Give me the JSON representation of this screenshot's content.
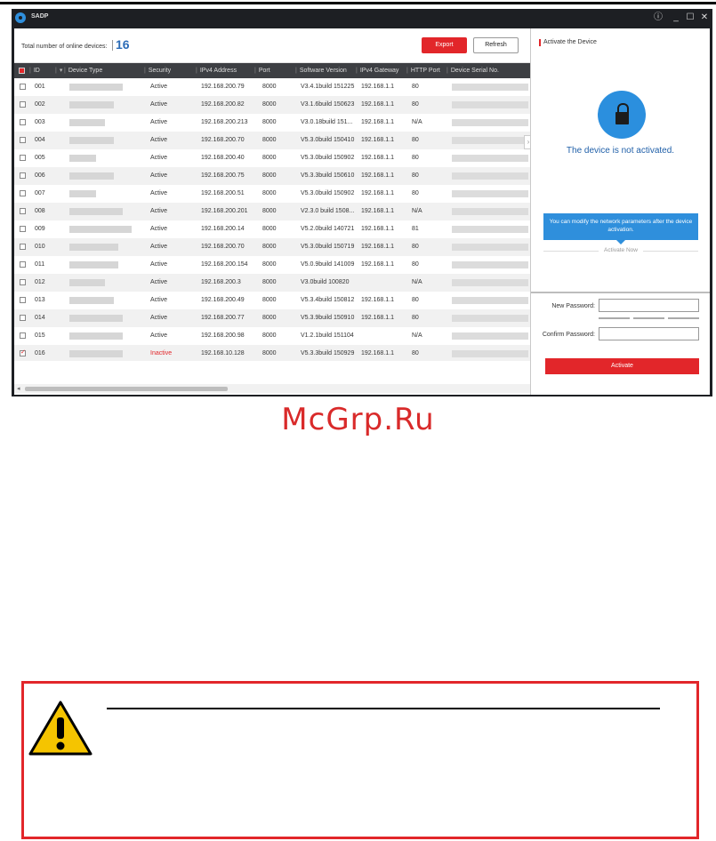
{
  "app": {
    "title": "SADP",
    "info_icon": "info-icon",
    "minimize_icon": "minimize-icon",
    "maximize_icon": "maximize-icon",
    "close_icon": "close-icon"
  },
  "toolbar": {
    "total_label": "Total number of online devices:",
    "total_count": "16",
    "export_label": "Export",
    "refresh_label": "Refresh"
  },
  "columns": [
    "ID",
    "Device Type",
    "Security",
    "IPv4 Address",
    "Port",
    "Software Version",
    "IPv4 Gateway",
    "HTTP Port",
    "Device Serial No."
  ],
  "rows": [
    {
      "id": "001",
      "security": "Active",
      "ip": "192.168.200.79",
      "port": "8000",
      "sw": "V3.4.1build 151225",
      "gw": "192.168.1.1",
      "http": "80",
      "checked": false
    },
    {
      "id": "002",
      "security": "Active",
      "ip": "192.168.200.82",
      "port": "8000",
      "sw": "V3.1.6build 150623",
      "gw": "192.168.1.1",
      "http": "80",
      "checked": false
    },
    {
      "id": "003",
      "security": "Active",
      "ip": "192.168.200.213",
      "port": "8000",
      "sw": "V3.0.18build 151...",
      "gw": "192.168.1.1",
      "http": "N/A",
      "checked": false
    },
    {
      "id": "004",
      "security": "Active",
      "ip": "192.168.200.70",
      "port": "8000",
      "sw": "V5.3.0build 150410",
      "gw": "192.168.1.1",
      "http": "80",
      "checked": false
    },
    {
      "id": "005",
      "security": "Active",
      "ip": "192.168.200.40",
      "port": "8000",
      "sw": "V5.3.0build 150902",
      "gw": "192.168.1.1",
      "http": "80",
      "checked": false
    },
    {
      "id": "006",
      "security": "Active",
      "ip": "192.168.200.75",
      "port": "8000",
      "sw": "V5.3.3build 150610",
      "gw": "192.168.1.1",
      "http": "80",
      "checked": false
    },
    {
      "id": "007",
      "security": "Active",
      "ip": "192.168.200.51",
      "port": "8000",
      "sw": "V5.3.0build 150902",
      "gw": "192.168.1.1",
      "http": "80",
      "checked": false
    },
    {
      "id": "008",
      "security": "Active",
      "ip": "192.168.200.201",
      "port": "8000",
      "sw": "V2.3.0 build 1508...",
      "gw": "192.168.1.1",
      "http": "N/A",
      "checked": false
    },
    {
      "id": "009",
      "security": "Active",
      "ip": "192.168.200.14",
      "port": "8000",
      "sw": "V5.2.0build 140721",
      "gw": "192.168.1.1",
      "http": "81",
      "checked": false
    },
    {
      "id": "010",
      "security": "Active",
      "ip": "192.168.200.70",
      "port": "8000",
      "sw": "V5.3.0build 150719",
      "gw": "192.168.1.1",
      "http": "80",
      "checked": false
    },
    {
      "id": "011",
      "security": "Active",
      "ip": "192.168.200.154",
      "port": "8000",
      "sw": "V5.0.9build 141009",
      "gw": "192.168.1.1",
      "http": "80",
      "checked": false
    },
    {
      "id": "012",
      "security": "Active",
      "ip": "192.168.200.3",
      "port": "8000",
      "sw": "V3.0build 100820",
      "gw": "",
      "http": "N/A",
      "checked": false
    },
    {
      "id": "013",
      "security": "Active",
      "ip": "192.168.200.49",
      "port": "8000",
      "sw": "V5.3.4build 150812",
      "gw": "192.168.1.1",
      "http": "80",
      "checked": false
    },
    {
      "id": "014",
      "security": "Active",
      "ip": "192.168.200.77",
      "port": "8000",
      "sw": "V5.3.9build 150910",
      "gw": "192.168.1.1",
      "http": "80",
      "checked": false
    },
    {
      "id": "015",
      "security": "Active",
      "ip": "192.168.200.98",
      "port": "8000",
      "sw": "V1.2.1build 151104",
      "gw": "",
      "http": "N/A",
      "checked": false
    },
    {
      "id": "016",
      "security": "Inactive",
      "ip": "192.168.10.128",
      "port": "8000",
      "sw": "V5.3.3build 150929",
      "gw": "192.168.1.1",
      "http": "80",
      "checked": true
    }
  ],
  "panel": {
    "title": "Activate the Device",
    "status": "The device is not activated.",
    "tooltip": "You can modify the network parameters after the device activation.",
    "activate_now": "Activate Now",
    "new_password_label": "New Password:",
    "confirm_password_label": "Confirm Password:",
    "activate_label": "Activate",
    "lock_icon": "lock-icon"
  },
  "watermark": "McGrp.Ru",
  "colors": {
    "accent_red": "#e2262a",
    "accent_blue": "#2f8fdc",
    "header_dark": "#3d3f43"
  }
}
